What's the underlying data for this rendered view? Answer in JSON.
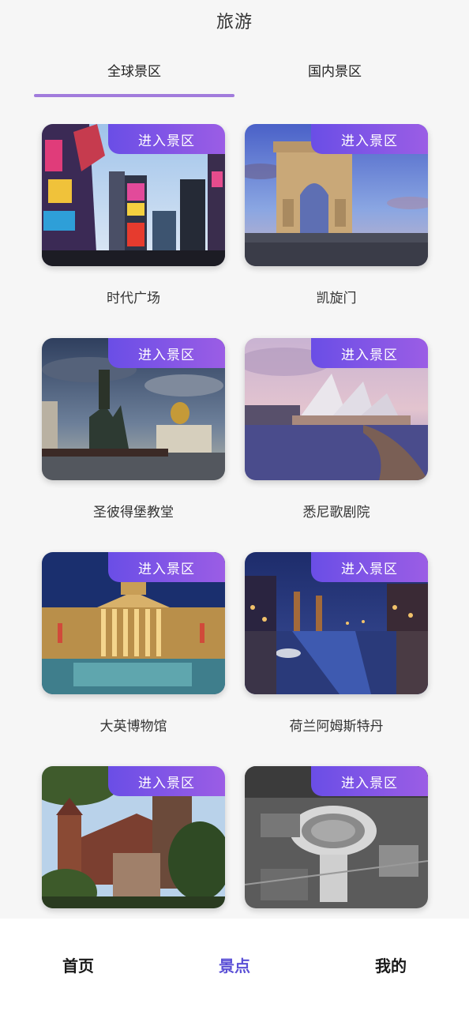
{
  "header": {
    "title": "旅游"
  },
  "tabs": [
    {
      "label": "全球景区",
      "active": true
    },
    {
      "label": "国内景区",
      "active": false
    }
  ],
  "card_action_label": "进入景区",
  "attractions": [
    {
      "name": "时代广场",
      "action": "进入景区",
      "image": "times-square-photo"
    },
    {
      "name": "凯旋门",
      "action": "进入景区",
      "image": "arc-de-triomphe-photo"
    },
    {
      "name": "圣彼得堡教堂",
      "action": "进入景区",
      "image": "st-petersburg-cathedral-photo"
    },
    {
      "name": "悉尼歌剧院",
      "action": "进入景区",
      "image": "sydney-opera-house-photo"
    },
    {
      "name": "大英博物馆",
      "action": "进入景区",
      "image": "british-museum-photo"
    },
    {
      "name": "荷兰阿姆斯特丹",
      "action": "进入景区",
      "image": "amsterdam-canal-photo"
    },
    {
      "name": "",
      "action": "进入景区",
      "image": "medieval-castle-photo"
    },
    {
      "name": "",
      "action": "进入景区",
      "image": "stadium-aerial-photo"
    }
  ],
  "bottom_nav": [
    {
      "label": "首页",
      "active": false
    },
    {
      "label": "景点",
      "active": true
    },
    {
      "label": "我的",
      "active": false
    }
  ],
  "colors": {
    "accent": "#5b50d6",
    "tab_indicator": "#a17bdc",
    "badge_gradient_start": "#6a4ee6",
    "badge_gradient_end": "#9b5de5"
  }
}
